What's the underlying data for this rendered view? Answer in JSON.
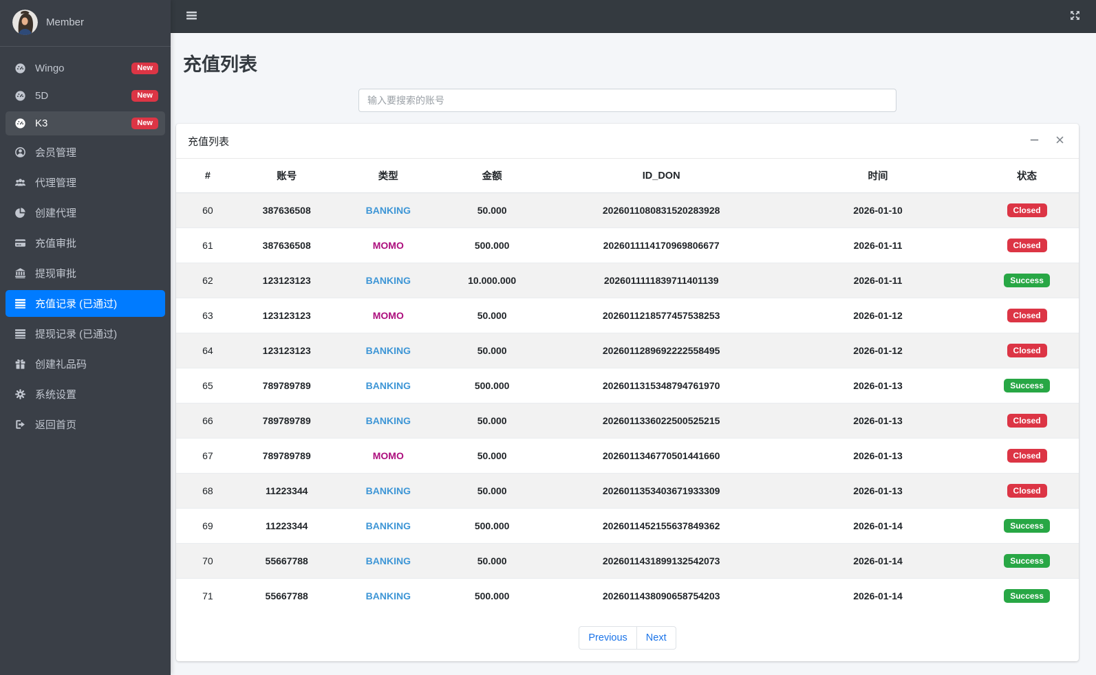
{
  "sidebar": {
    "user": {
      "name": "Member"
    },
    "items": [
      {
        "label": "Wingo",
        "badge": "New",
        "icon": "gauge-icon",
        "active": ""
      },
      {
        "label": "5D",
        "badge": "New",
        "icon": "gauge-icon",
        "active": ""
      },
      {
        "label": "K3",
        "badge": "New",
        "icon": "gauge-icon",
        "active": "dark"
      },
      {
        "label": "会员管理",
        "badge": "",
        "icon": "user-circle-icon",
        "active": ""
      },
      {
        "label": "代理管理",
        "badge": "",
        "icon": "users-icon",
        "active": ""
      },
      {
        "label": "创建代理",
        "badge": "",
        "icon": "pie-chart-icon",
        "active": ""
      },
      {
        "label": "充值审批",
        "badge": "",
        "icon": "credit-card-icon",
        "active": ""
      },
      {
        "label": "提现审批",
        "badge": "",
        "icon": "bank-icon",
        "active": ""
      },
      {
        "label": "充值记录 (已通过)",
        "badge": "",
        "icon": "list-icon",
        "active": "primary"
      },
      {
        "label": "提现记录 (已通过)",
        "badge": "",
        "icon": "list-icon",
        "active": ""
      },
      {
        "label": "创建礼品码",
        "badge": "",
        "icon": "gift-icon",
        "active": ""
      },
      {
        "label": "系统设置",
        "badge": "",
        "icon": "gear-icon",
        "active": ""
      },
      {
        "label": "返回首页",
        "badge": "",
        "icon": "sign-out-icon",
        "active": ""
      }
    ]
  },
  "page": {
    "title": "充值列表"
  },
  "search": {
    "placeholder": "输入要搜索的账号",
    "value": ""
  },
  "card": {
    "title": "充值列表"
  },
  "table": {
    "headers": [
      "#",
      "账号",
      "类型",
      "金额",
      "ID_DON",
      "时间",
      "状态"
    ],
    "rows": [
      {
        "num": "60",
        "account": "387636508",
        "type": "BANKING",
        "amount": "50.000",
        "id_don": "2026011080831520283928",
        "date": "2026-01-10",
        "status": "Closed"
      },
      {
        "num": "61",
        "account": "387636508",
        "type": "MOMO",
        "amount": "500.000",
        "id_don": "2026011114170969806677",
        "date": "2026-01-11",
        "status": "Closed"
      },
      {
        "num": "62",
        "account": "123123123",
        "type": "BANKING",
        "amount": "10.000.000",
        "id_don": "2026011111839711401139",
        "date": "2026-01-11",
        "status": "Success"
      },
      {
        "num": "63",
        "account": "123123123",
        "type": "MOMO",
        "amount": "50.000",
        "id_don": "2026011218577457538253",
        "date": "2026-01-12",
        "status": "Closed"
      },
      {
        "num": "64",
        "account": "123123123",
        "type": "BANKING",
        "amount": "50.000",
        "id_don": "2026011289692222558495",
        "date": "2026-01-12",
        "status": "Closed"
      },
      {
        "num": "65",
        "account": "789789789",
        "type": "BANKING",
        "amount": "500.000",
        "id_don": "2026011315348794761970",
        "date": "2026-01-13",
        "status": "Success"
      },
      {
        "num": "66",
        "account": "789789789",
        "type": "BANKING",
        "amount": "50.000",
        "id_don": "2026011336022500525215",
        "date": "2026-01-13",
        "status": "Closed"
      },
      {
        "num": "67",
        "account": "789789789",
        "type": "MOMO",
        "amount": "50.000",
        "id_don": "2026011346770501441660",
        "date": "2026-01-13",
        "status": "Closed"
      },
      {
        "num": "68",
        "account": "11223344",
        "type": "BANKING",
        "amount": "50.000",
        "id_don": "2026011353403671933309",
        "date": "2026-01-13",
        "status": "Closed"
      },
      {
        "num": "69",
        "account": "11223344",
        "type": "BANKING",
        "amount": "500.000",
        "id_don": "2026011452155637849362",
        "date": "2026-01-14",
        "status": "Success"
      },
      {
        "num": "70",
        "account": "55667788",
        "type": "BANKING",
        "amount": "50.000",
        "id_don": "2026011431899132542073",
        "date": "2026-01-14",
        "status": "Success"
      },
      {
        "num": "71",
        "account": "55667788",
        "type": "BANKING",
        "amount": "500.000",
        "id_don": "2026011438090658754203",
        "date": "2026-01-14",
        "status": "Success"
      }
    ]
  },
  "pagination": {
    "previous": "Previous",
    "next": "Next"
  },
  "colors": {
    "sidebar_bg": "#3a3f47",
    "topbar_bg": "#343a40",
    "active_primary": "#007bff",
    "banking_text": "#3e96d6",
    "momo_text": "#ad0e7d",
    "badge_success": "#28a745",
    "badge_closed": "#dc3545",
    "badge_new": "#dc3545",
    "page_bg": "#f4f6f9"
  }
}
